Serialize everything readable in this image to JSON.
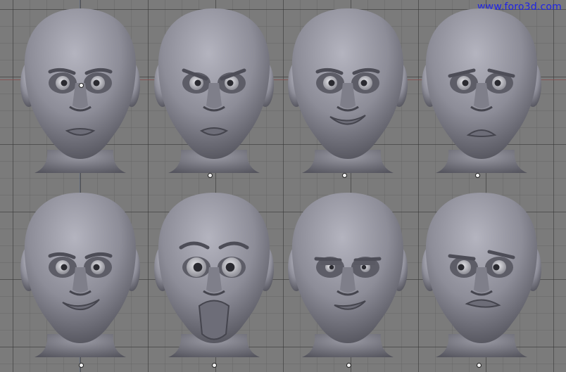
{
  "watermark": {
    "text": "www.foro3d.com",
    "color": "#1f23e6"
  },
  "viewport": {
    "background": "#7b7b7b",
    "grid": true
  },
  "heads": [
    {
      "expression": "neutral"
    },
    {
      "expression": "angry"
    },
    {
      "expression": "sly-grin"
    },
    {
      "expression": "sad"
    },
    {
      "expression": "smile"
    },
    {
      "expression": "shocked"
    },
    {
      "expression": "smug"
    },
    {
      "expression": "skeptical"
    }
  ],
  "icons": [
    "object-origin-icon"
  ]
}
